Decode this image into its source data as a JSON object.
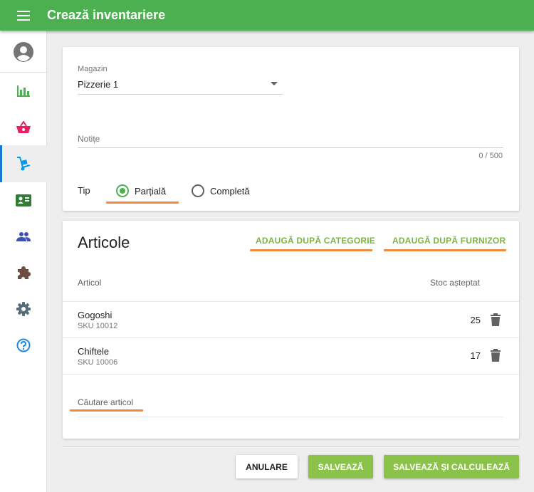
{
  "appbar": {
    "title": "Crează inventariere",
    "menu_icon": "hamburger-menu-icon"
  },
  "sidebar": {
    "items": [
      {
        "name": "account",
        "icon": "account-circle-icon",
        "color": "#757575"
      },
      {
        "name": "reports",
        "icon": "bar-chart-icon",
        "color": "#4caf50"
      },
      {
        "name": "sales",
        "icon": "basket-icon",
        "color": "#e91e63"
      },
      {
        "name": "inventory",
        "icon": "dolly-icon",
        "color": "#039be5",
        "active": true
      },
      {
        "name": "contacts",
        "icon": "contact-card-icon",
        "color": "#2e7d32"
      },
      {
        "name": "users",
        "icon": "people-icon",
        "color": "#3f51b5"
      },
      {
        "name": "integrations",
        "icon": "puzzle-icon",
        "color": "#6d4c41"
      },
      {
        "name": "settings",
        "icon": "gear-icon",
        "color": "#546e7a"
      },
      {
        "name": "help",
        "icon": "help-circle-icon",
        "color": "#1e88e5"
      }
    ]
  },
  "form": {
    "store_label": "Magazin",
    "store_value": "Pizzerie 1",
    "notes_placeholder": "Notițe",
    "notes_counter": "0 / 500",
    "type_label": "Tip",
    "type_options": [
      {
        "label": "Parțială",
        "selected": true
      },
      {
        "label": "Completă",
        "selected": false
      }
    ]
  },
  "articles": {
    "title": "Articole",
    "add_by_category": "ADAUGĂ DUPĂ CATEGORIE",
    "add_by_supplier": "ADAUGĂ DUPĂ FURNIZOR",
    "col_article": "Articol",
    "col_expected_stock": "Stoc așteptat",
    "rows": [
      {
        "name": "Gogoshi",
        "sku": "SKU 10012",
        "qty": "25"
      },
      {
        "name": "Chiftele",
        "sku": "SKU 10006",
        "qty": "17"
      }
    ],
    "search_placeholder": "Căutare articol"
  },
  "actions": {
    "cancel": "ANULARE",
    "save": "SALVEAZĂ",
    "save_calculate": "SALVEAZĂ ȘI CALCULEAZĂ"
  },
  "colors": {
    "primary": "#4caf50",
    "accent": "#8bc34a",
    "highlight": "#f08a3c"
  }
}
